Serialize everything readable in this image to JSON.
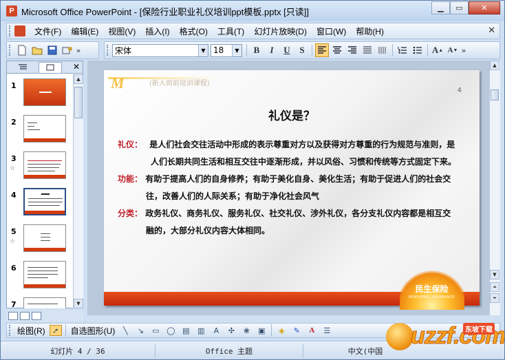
{
  "window": {
    "title": "Microsoft Office PowerPoint - [保险行业职业礼仪培训ppt模板.pptx [只读]]"
  },
  "menubar": {
    "items": [
      "文件(F)",
      "编辑(E)",
      "视图(V)",
      "插入(I)",
      "格式(O)",
      "工具(T)",
      "幻灯片放映(D)",
      "窗口(W)",
      "帮助(H)"
    ]
  },
  "toolbar": {
    "font_name": "宋体",
    "font_size": "18",
    "bold": "B",
    "italic": "I",
    "underline": "U",
    "shadow": "S"
  },
  "panel": {
    "slides": [
      "1",
      "2",
      "3",
      "4",
      "5",
      "6",
      "7"
    ],
    "selected": "4"
  },
  "slide": {
    "header": "(新人岗前培训课程)",
    "page_number": "4",
    "title": "礼仪是？",
    "p1_label": "礼仪：",
    "p1_line1": "是人们社会交往活动中形成的表示尊重对方以及获得对方尊重的行为规范与准则，是",
    "p1_line2": "人们长期共同生活和相互交往中逐渐形成，并以风俗、习惯和传统等方式固定下来。",
    "p2_label": "功能：",
    "p2_line1": "有助于提高人们的自身修养；有助于美化自身、美化生活；有助于促进人们的社会交",
    "p2_line2": "往，改善人们的人际关系；有助于净化社会风气",
    "p3_label": "分类：",
    "p3_line1": "政务礼仪、商务礼仪、服务礼仪、社交礼仪、涉外礼仪，各分支礼仪内容都是相互交",
    "p3_line2": "融的，大部分礼仪内容大体相同。",
    "brand": "民生保险",
    "brand_sub": "MINSHENG INSURANCE"
  },
  "drawbar": {
    "draw": "绘图(R)",
    "autoshapes": "自选图形(U)"
  },
  "status": {
    "slide": "幻灯片 4 / 36",
    "theme": "Office 主题",
    "lang": "中文(中国"
  },
  "watermark": {
    "text": "uzzf.com",
    "badge": "东坡下载"
  },
  "colors": {
    "accent_red": "#c0202b",
    "band": "#d33b0f",
    "chrome": "#cfe0f3"
  }
}
